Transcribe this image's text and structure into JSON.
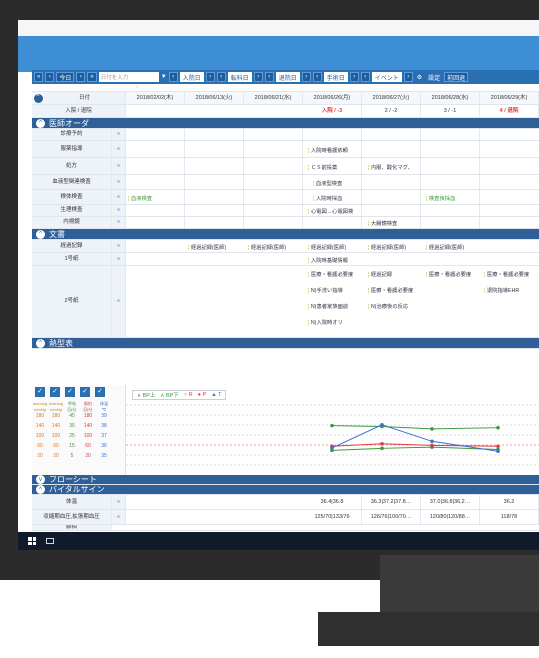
{
  "toolbar": {
    "today": "今日",
    "date_placeholder": "日付を入力",
    "admission": "入院日",
    "transfer": "転科日",
    "discharge": "退院日",
    "surgery": "手術日",
    "event": "イベント",
    "settings": "設定",
    "last": "前回退"
  },
  "dates_header": {
    "label": "日付",
    "sublabel": "入院 / 退院",
    "dates": [
      "2018/02/02(木)",
      "2018/06/13(火)",
      "2018/06/21(水)",
      "2018/06/26(月)",
      "2018/06/27(火)",
      "2018/06/28(水)",
      "2018/06/29(木)"
    ],
    "days": [
      "",
      "",
      "",
      "入院 / -3",
      "2 / -2",
      "3 / -1",
      "4 / 退院"
    ]
  },
  "sections": {
    "orders": "医師オーダ",
    "documents": "文書",
    "temperature": "熱型表",
    "flowsheet": "フローシート",
    "vitals": "バイタルサイン"
  },
  "order_rows": [
    "診療予約",
    "服薬指導",
    "処方",
    "血液型関連検査",
    "検体検査",
    "生理検査",
    "内視鏡"
  ],
  "order_entries": {
    "r1": "入院時看護依頼",
    "r2a": "ＣＳ前投薬",
    "r2b": "内服、酸化マグ、",
    "r3": "血液型検査",
    "r4a": "血液検査",
    "r4b": "入院時採血",
    "r4c": "検査後採血",
    "r5": "心電図→心電図検",
    "r6": "大腸鏡検査"
  },
  "doc_rows": [
    "経過記録",
    "1号紙",
    "2号紙"
  ],
  "doc_entries": {
    "progress": "経過記録(医師)",
    "no1": "入院時基礎情報",
    "no2": [
      [
        "医療・看護必要度",
        "経過記録",
        "医療・看護必要度",
        "医療・看護必要度"
      ],
      [
        "N)手洗い指導",
        "医療・看護必要度",
        "退院指導EHR"
      ],
      [
        "N)患者家族面談",
        "N)治療後の反応"
      ],
      [
        "N)入院時オリ"
      ]
    ]
  },
  "temp_chart": {
    "legend": [
      "BP上",
      "BP下",
      "R",
      "P",
      "T"
    ],
    "scale_headers": [
      "morning",
      "evening",
      "呼吸",
      "脈拍",
      "体温"
    ],
    "scale_units": [
      "mmHg",
      "mmHg",
      "回/分",
      "回/分",
      "℃"
    ],
    "scale_cols": [
      [
        "180",
        "140",
        "100",
        "60",
        "20"
      ],
      [
        "180",
        "140",
        "100",
        "60",
        "20"
      ],
      [
        "45",
        "35",
        "25",
        "15",
        "5"
      ],
      [
        "180",
        "140",
        "100",
        "60",
        "20"
      ],
      [
        "39",
        "38",
        "37",
        "36",
        "35"
      ]
    ]
  },
  "vital_rows": [
    "体温",
    "収縮期血圧,拡張期血圧",
    "脈拍"
  ],
  "vital_values": {
    "temp": [
      "36.4|36.8",
      "36.3|37.2|37.8…",
      "37.0|36.8|36.2…",
      "36.2"
    ],
    "bp": [
      "125/70|133/76",
      "126/76|100/70…",
      "120/80|120/88…",
      "118/78"
    ]
  },
  "colors": {
    "header_blue": "#3f8fd6",
    "section_blue": "#2f5f97",
    "alert_red": "#e03b3b",
    "green": "#3a9a3a"
  },
  "chart_data": {
    "type": "line",
    "x": [
      "2018/06/26",
      "2018/06/27",
      "2018/06/28",
      "2018/06/29"
    ],
    "series": [
      {
        "name": "BP上",
        "values": [
          130,
          128,
          122,
          125
        ]
      },
      {
        "name": "BP下",
        "values": [
          70,
          75,
          78,
          72
        ]
      },
      {
        "name": "P",
        "values": [
          80,
          86,
          82,
          80
        ]
      },
      {
        "name": "T",
        "values": [
          36.4,
          37.8,
          36.8,
          36.2
        ]
      }
    ]
  }
}
